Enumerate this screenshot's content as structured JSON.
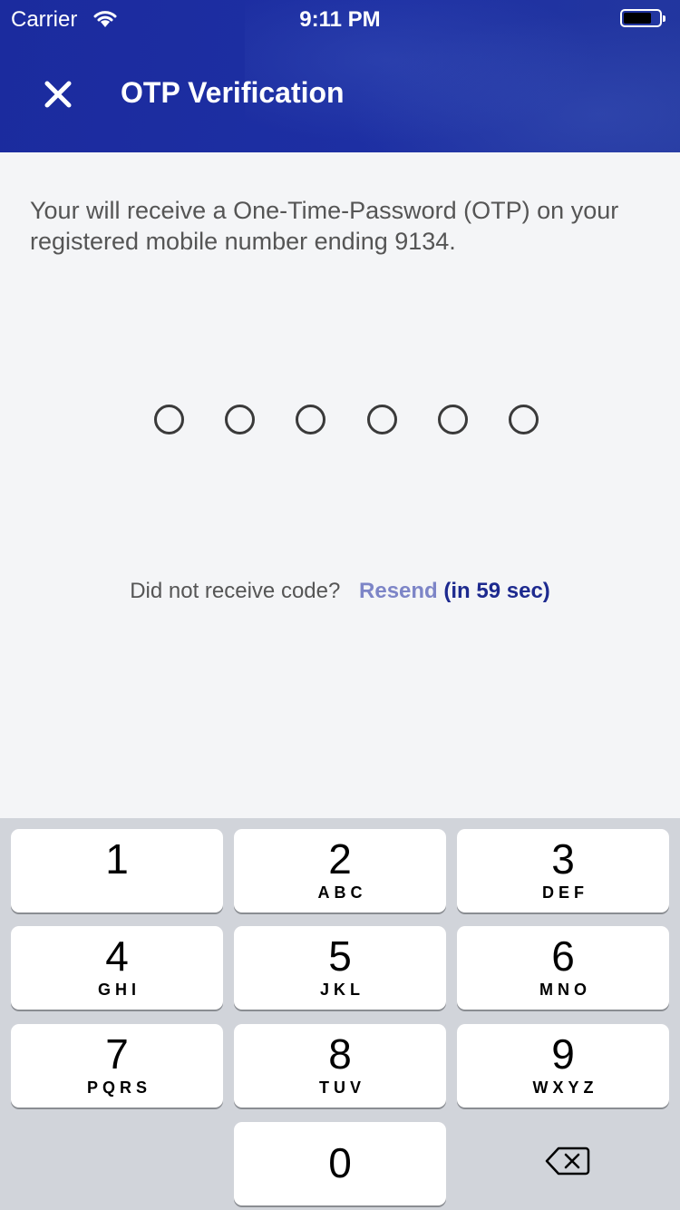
{
  "status_bar": {
    "carrier": "Carrier",
    "time": "9:11 PM"
  },
  "header": {
    "title": "OTP Verification",
    "close_icon": "close-icon",
    "background_color": "#1d2fa3"
  },
  "main": {
    "message": "Your will receive a One-Time-Password (OTP) on your registered mobile number ending 9134.",
    "otp_length": 6,
    "otp_value": "",
    "resend_prompt": "Did not receive code?",
    "resend_label": "Resend",
    "resend_timer": "(in 59 sec)",
    "resend_color": "#7d85c7",
    "timer_color": "#1d2a8f"
  },
  "keypad": {
    "keys": [
      {
        "digit": "1",
        "letters": ""
      },
      {
        "digit": "2",
        "letters": "ABC"
      },
      {
        "digit": "3",
        "letters": "DEF"
      },
      {
        "digit": "4",
        "letters": "GHI"
      },
      {
        "digit": "5",
        "letters": "JKL"
      },
      {
        "digit": "6",
        "letters": "MNO"
      },
      {
        "digit": "7",
        "letters": "PQRS"
      },
      {
        "digit": "8",
        "letters": "TUV"
      },
      {
        "digit": "9",
        "letters": "WXYZ"
      },
      {
        "digit": "0",
        "letters": ""
      }
    ],
    "backspace_icon": "backspace-icon"
  }
}
